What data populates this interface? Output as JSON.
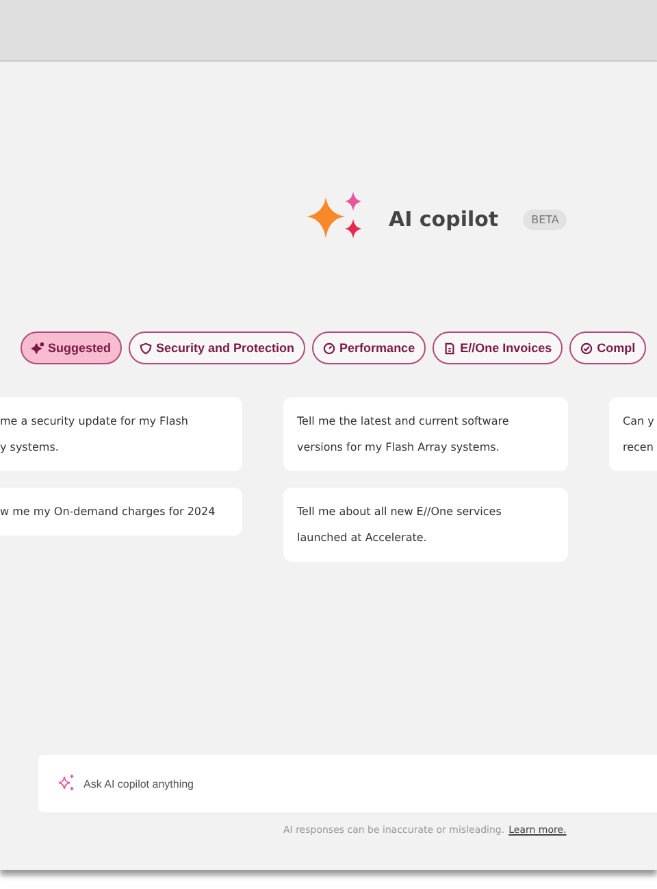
{
  "header": {
    "title": "AI copilot",
    "badge": "BETA"
  },
  "chips": [
    {
      "label": "Suggested",
      "selected": true
    },
    {
      "label": "Security and Protection",
      "selected": false
    },
    {
      "label": "Performance",
      "selected": false
    },
    {
      "label": "E//One Invoices",
      "selected": false
    },
    {
      "label": "Compl",
      "selected": false
    }
  ],
  "columns": [
    {
      "cards": [
        {
          "lines": [
            "me a security update for my Flash",
            "y systems."
          ]
        },
        {
          "lines": [
            "w me my On-demand charges for 2024"
          ]
        }
      ]
    },
    {
      "cards": [
        {
          "lines": [
            "Tell me the latest and current software",
            "versions for my Flash Array systems."
          ]
        },
        {
          "lines": [
            "Tell me about all new E//One services",
            "launched at Accelerate."
          ]
        }
      ]
    },
    {
      "cards": [
        {
          "lines": [
            "Can y",
            "recen"
          ]
        }
      ]
    }
  ],
  "input": {
    "placeholder": "Ask AI copilot anything"
  },
  "disclaimer": {
    "text": "AI responses can be inaccurate or misleading.",
    "link": "Learn more."
  }
}
